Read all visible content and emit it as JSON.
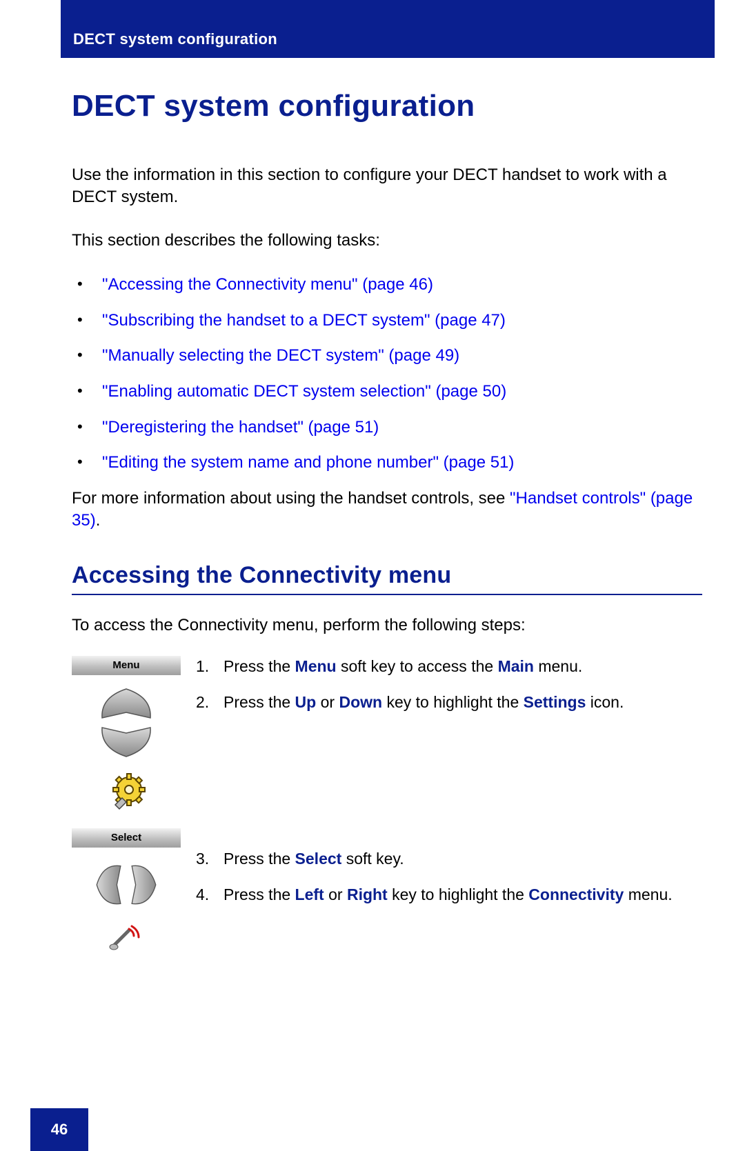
{
  "header": {
    "title": "DECT system configuration"
  },
  "title": "DECT system configuration",
  "intro1": "Use the information in this section to configure your DECT handset to work with a DECT system.",
  "intro2": "This section describes the following tasks:",
  "toc": {
    "items": [
      "\"Accessing the Connectivity menu\" (page 46)",
      "\"Subscribing the handset to a DECT system\" (page 47)",
      "\"Manually selecting the DECT system\" (page 49)",
      "\"Enabling automatic DECT system selection\" (page 50)",
      "\"Deregistering the handset\" (page 51)",
      "\"Editing the system name and phone number\" (page 51)"
    ]
  },
  "more_info_pre": "For more information about using the handset controls, see ",
  "more_info_link": "\"Handset controls\" (page 35)",
  "more_info_post": ".",
  "section_heading": "Accessing the Connectivity menu",
  "section_intro": "To access the Connectivity menu, perform the following steps:",
  "softkeys": {
    "menu": "Menu",
    "select": "Select"
  },
  "steps": {
    "s1_a": "Press the ",
    "s1_b": "Menu",
    "s1_c": " soft key to access the ",
    "s1_d": "Main",
    "s1_e": " menu.",
    "s2_a": "Press the ",
    "s2_b": "Up",
    "s2_c": " or ",
    "s2_d": "Down",
    "s2_e": " key to highlight the ",
    "s2_f": "Settings",
    "s2_g": " icon.",
    "s3_a": "Press the ",
    "s3_b": "Select",
    "s3_c": " soft key.",
    "s4_a": "Press the ",
    "s4_b": "Left",
    "s4_c": " or ",
    "s4_d": "Right",
    "s4_e": " key to highlight the ",
    "s4_f": "Connectivity",
    "s4_g": " menu."
  },
  "page_number": "46"
}
